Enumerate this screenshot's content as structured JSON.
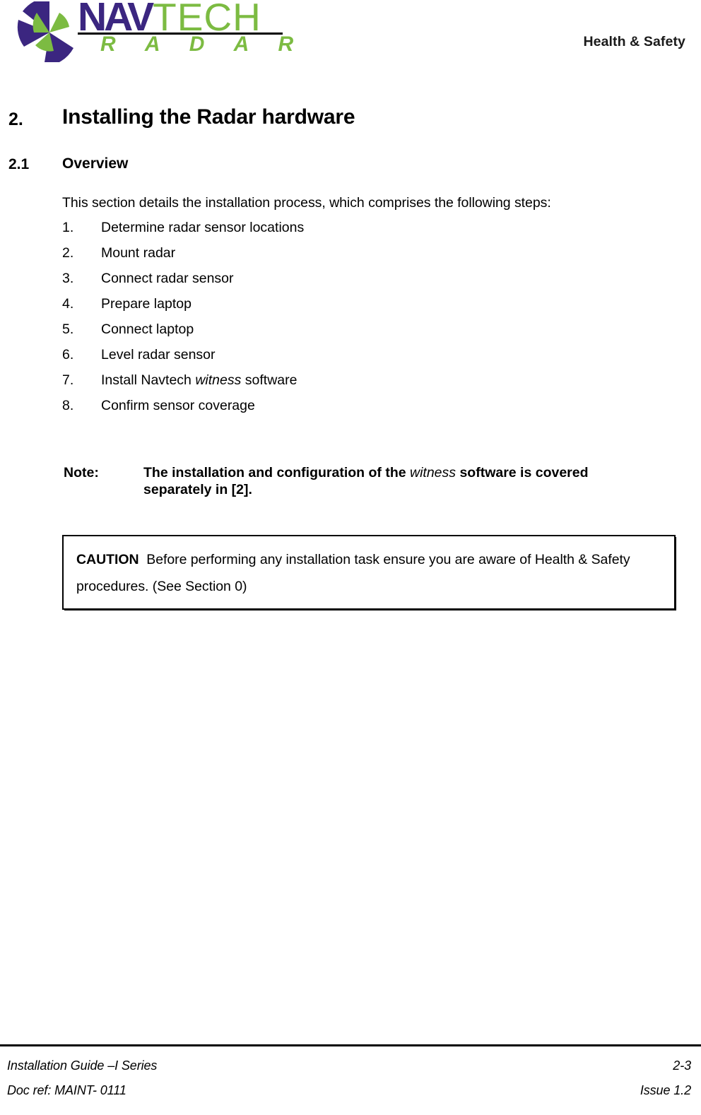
{
  "header": {
    "logo": {
      "mark_name": "navtech-radar-pinwheel-logo",
      "word_nav": "NAV",
      "word_tech": "TECH",
      "word_radar": "R A D A R",
      "color_purple": "#3B2680",
      "color_green": "#7CBB42"
    },
    "right_text": "Health & Safety"
  },
  "section": {
    "number": "2.",
    "title": "Installing the Radar hardware",
    "sub_number": "2.1",
    "sub_title": "Overview",
    "intro": "This section details the installation process, which comprises the following steps:",
    "steps": [
      {
        "num": "1.",
        "label": "Determine radar sensor locations"
      },
      {
        "num": "2.",
        "label": "Mount radar"
      },
      {
        "num": "3.",
        "label": "Connect radar sensor"
      },
      {
        "num": "4.",
        "label": "Prepare laptop"
      },
      {
        "num": "5.",
        "label": "Connect laptop"
      },
      {
        "num": "6.",
        "label": "Level radar sensor"
      },
      {
        "num": "7.",
        "label": "Install Navtech witness software",
        "pre": "Install Navtech ",
        "italic": "witness",
        "post": " software"
      },
      {
        "num": "8.",
        "label": "Confirm sensor coverage"
      }
    ]
  },
  "note": {
    "label": "Note:",
    "pre": "The installation and configuration of the ",
    "italic": "witness",
    "post": " software is covered separately in [2]."
  },
  "caution": {
    "word": "CAUTION",
    "text": "Before performing any installation task ensure you are aware of Health & Safety procedures. (See Section 0)"
  },
  "footer": {
    "left_1": "Installation Guide –I Series",
    "right_1": "2-3",
    "left_2": "Doc ref: MAINT- 0111",
    "right_2": "Issue 1.2"
  }
}
